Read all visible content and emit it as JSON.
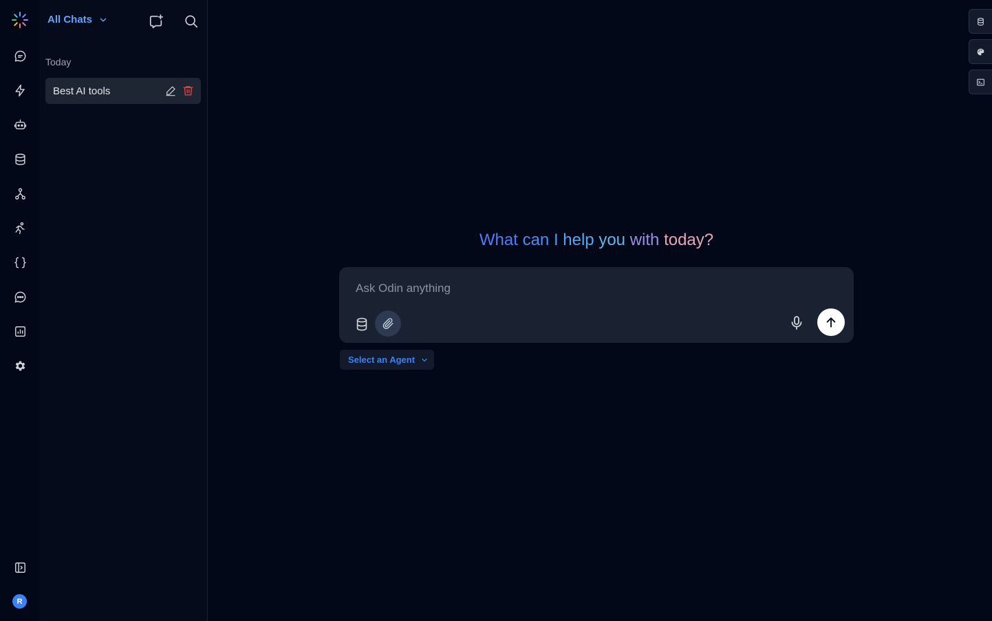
{
  "panel": {
    "title": "All Chats",
    "section_today": "Today",
    "chats": [
      {
        "title": "Best AI tools"
      }
    ]
  },
  "main": {
    "heading_words": [
      "What",
      "can",
      "I",
      "help",
      "you",
      "with",
      "today?"
    ],
    "heading_colors": [
      "#4f7df5",
      "#4f8af6",
      "#4f97f6",
      "#52a7f5",
      "#5bb7f0",
      "#9b8ee6",
      "#e8a5b8"
    ],
    "composer": {
      "placeholder": "Ask Odin anything"
    },
    "agent_select_label": "Select an Agent"
  },
  "user": {
    "avatar_initial": "R"
  },
  "colors": {
    "accent": "#3b82f6",
    "background": "#020817",
    "delete": "#ef4444"
  }
}
